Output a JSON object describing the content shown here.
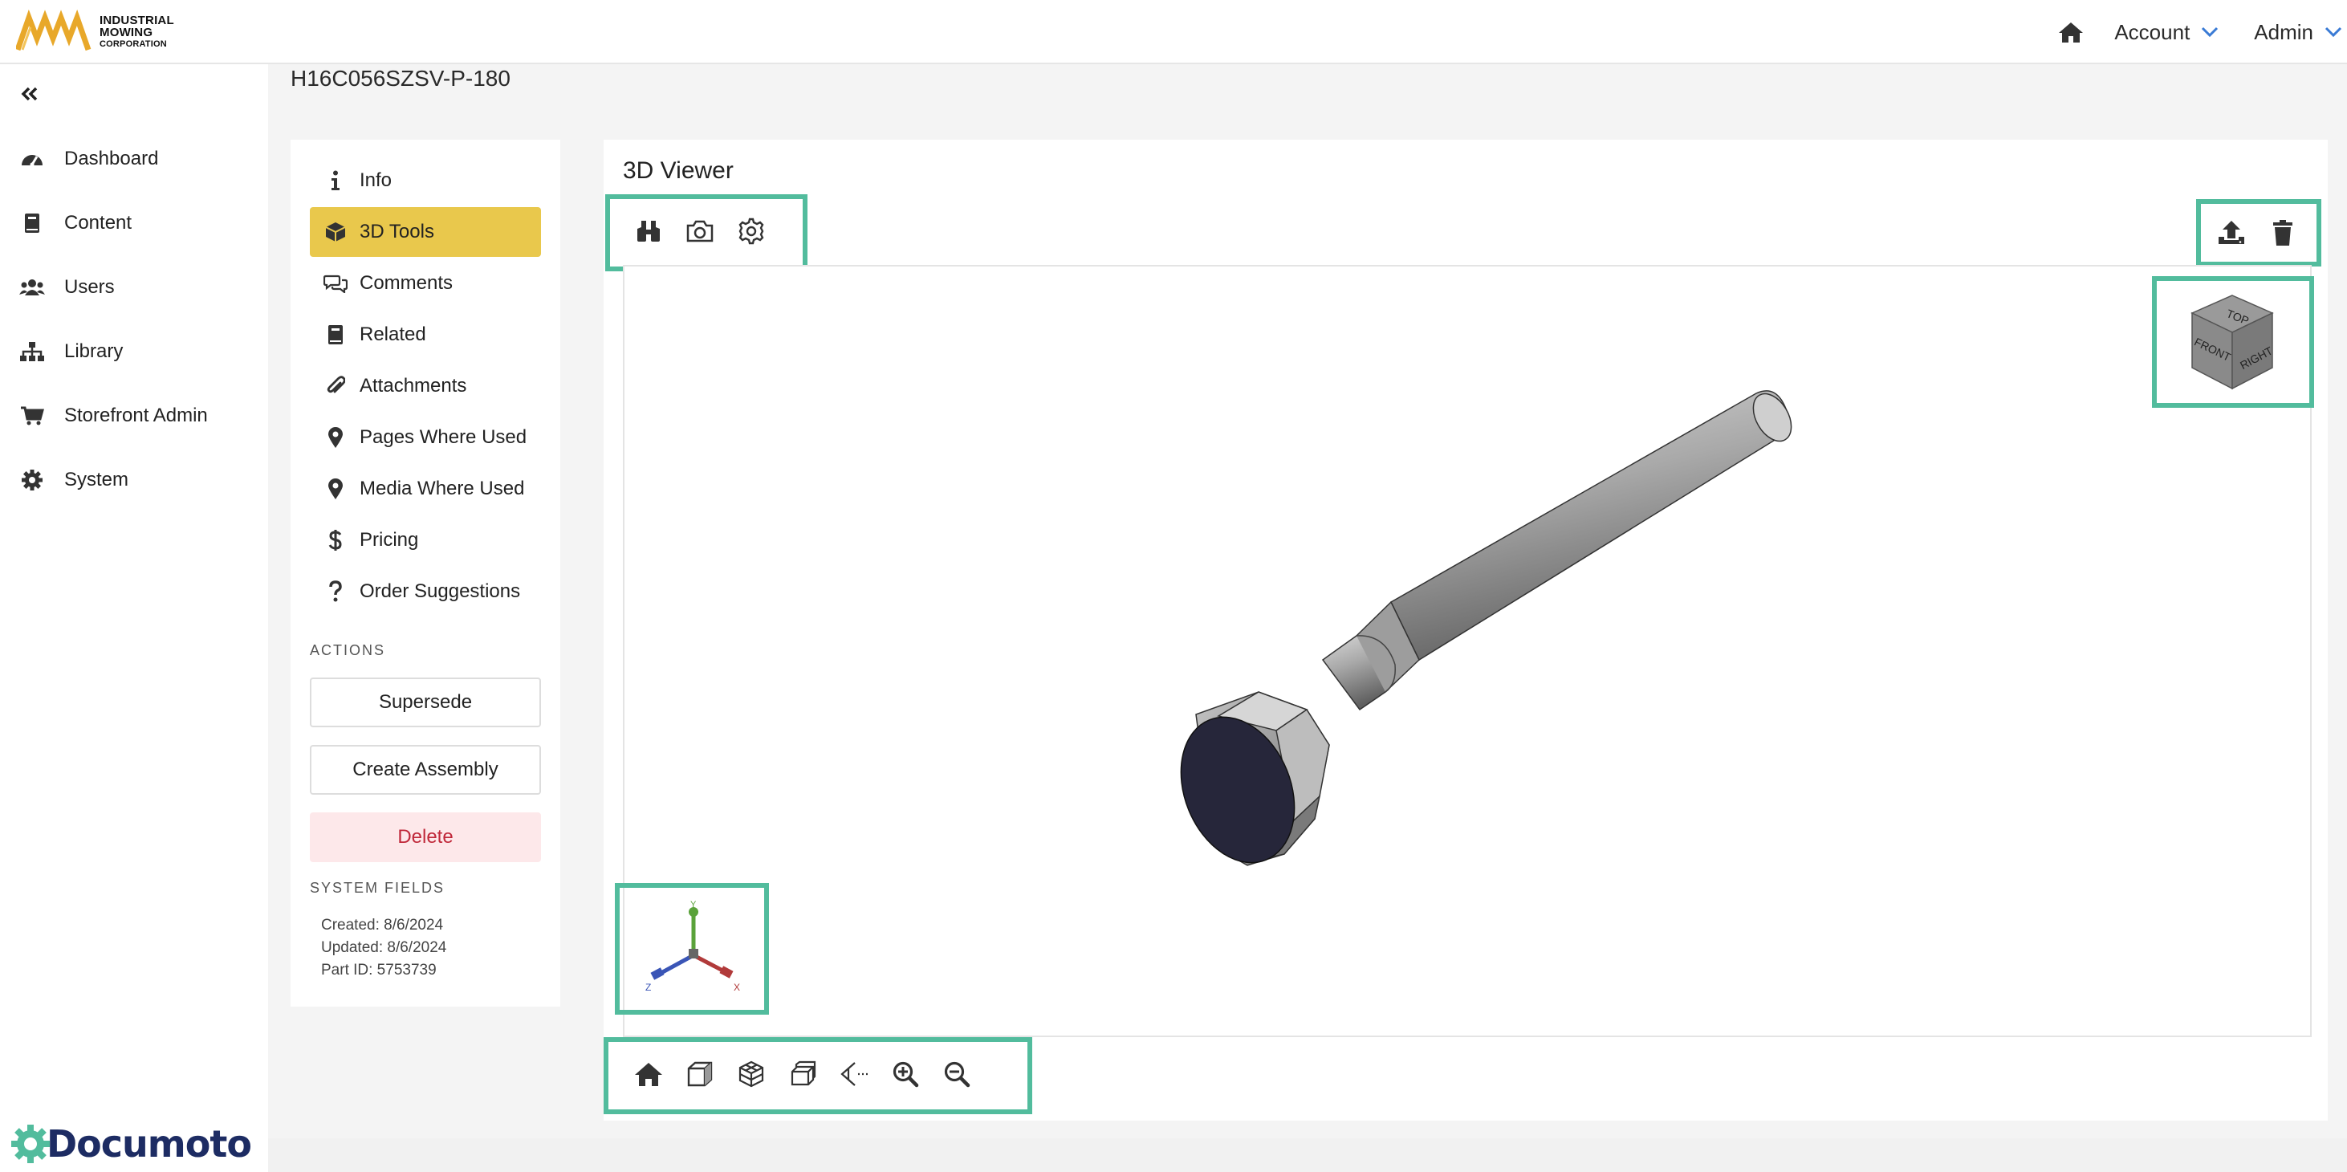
{
  "header": {
    "logo_lines": [
      "INDUSTRIAL",
      "MOWING",
      "CORPORATION"
    ],
    "account_label": "Account",
    "admin_label": "Admin"
  },
  "sidebar": {
    "items": [
      {
        "label": "Dashboard",
        "icon": "dashboard-icon"
      },
      {
        "label": "Content",
        "icon": "book-icon"
      },
      {
        "label": "Users",
        "icon": "users-icon"
      },
      {
        "label": "Library",
        "icon": "sitemap-icon"
      },
      {
        "label": "Storefront Admin",
        "icon": "cart-icon"
      },
      {
        "label": "System",
        "icon": "gear-icon"
      }
    ],
    "brand": "Documoto"
  },
  "page": {
    "title": "H16C056SZSV-P-180"
  },
  "subnav": {
    "items": [
      {
        "label": "Info",
        "icon": "info-icon"
      },
      {
        "label": "3D Tools",
        "icon": "cube-icon",
        "active": true
      },
      {
        "label": "Comments",
        "icon": "comments-icon"
      },
      {
        "label": "Related",
        "icon": "book-icon"
      },
      {
        "label": "Attachments",
        "icon": "paperclip-icon"
      },
      {
        "label": "Pages Where Used",
        "icon": "map-marker-icon"
      },
      {
        "label": "Media Where Used",
        "icon": "map-marker-icon"
      },
      {
        "label": "Pricing",
        "icon": "dollar-icon"
      },
      {
        "label": "Order Suggestions",
        "icon": "question-icon"
      }
    ],
    "actions_label": "ACTIONS",
    "supersede_label": "Supersede",
    "create_assembly_label": "Create Assembly",
    "delete_label": "Delete",
    "system_fields_label": "SYSTEM FIELDS",
    "created": "Created: 8/6/2024",
    "updated": "Updated: 8/6/2024",
    "part_id": "Part ID: 5753739"
  },
  "viewer": {
    "title": "3D Viewer",
    "top_tools": [
      "binoculars-icon",
      "camera-icon",
      "settings-icon"
    ],
    "right_tools": [
      "upload-icon",
      "trash-icon"
    ],
    "cube_faces": {
      "top": "TOP",
      "front": "FRONT",
      "right": "RIGHT"
    },
    "axes": {
      "x": "X",
      "y": "Y",
      "z": "Z"
    },
    "bottom_tools": [
      "home-icon",
      "cube-solid-icon",
      "cube-wire-icon",
      "cube-section-icon",
      "eye-section-icon",
      "zoom-in-icon",
      "zoom-out-icon"
    ]
  },
  "colors": {
    "accent": "#e9c84c",
    "highlight": "#52bc9d",
    "brand_navy": "#1d2c63",
    "danger": "#c0283a",
    "logo_gold": "#e8a82a"
  }
}
